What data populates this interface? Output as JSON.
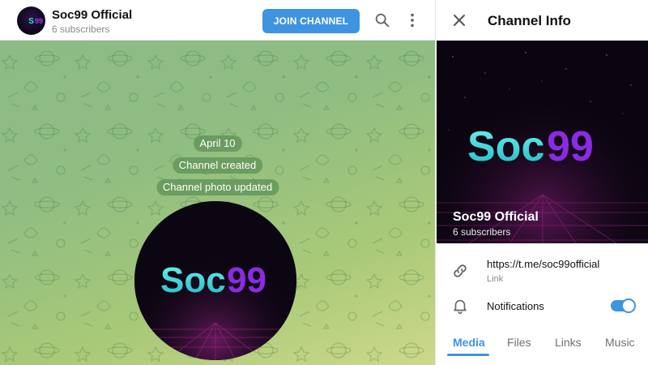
{
  "chat": {
    "title": "Soc99 Official",
    "subscribers": "6 subscribers",
    "join_label": "JOIN CHANNEL",
    "icons": {
      "search": "search-icon",
      "more": "more-vertical-icon"
    },
    "service_messages": {
      "date": "April 10",
      "created": "Channel created",
      "photo_updated": "Channel photo updated"
    }
  },
  "logo": {
    "word": "Soc",
    "digits": "99"
  },
  "info": {
    "title": "Channel Info",
    "close_icon": "close-icon",
    "name": "Soc99 Official",
    "subscribers": "6 subscribers",
    "link": "https://t.me/soc99official",
    "link_label": "Link",
    "notifications_label": "Notifications",
    "notifications_on": true,
    "tabs": [
      "Media",
      "Files",
      "Links",
      "Music"
    ],
    "active_tab": "Media"
  },
  "colors": {
    "accent": "#3e94e0",
    "logo_cyan": "#35e0d8",
    "logo_purple": "#8a2be2",
    "chat_bg": "#8fbd82"
  }
}
